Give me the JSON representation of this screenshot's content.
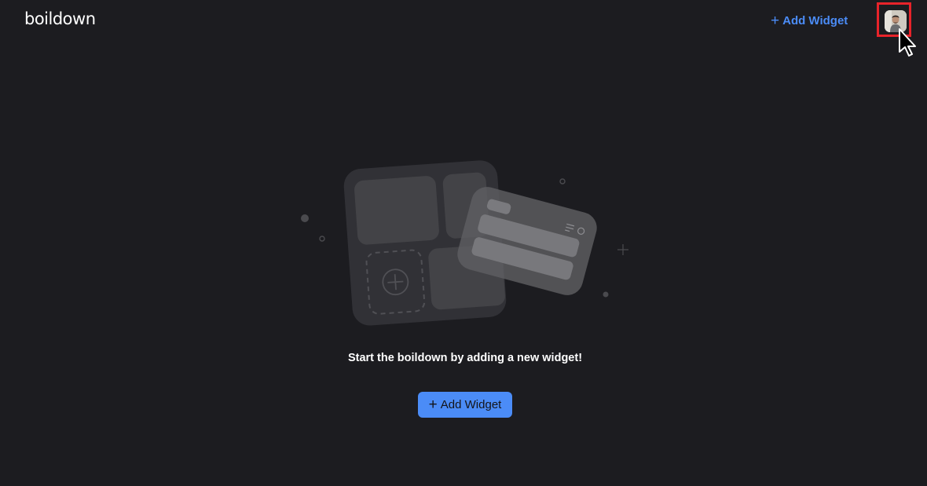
{
  "app": {
    "name": "boildown"
  },
  "header": {
    "add_widget_icon": "plus-icon",
    "add_widget_plus": "+",
    "add_widget_label": "Add Widget",
    "avatar_icon": "user-avatar",
    "highlight_color": "#e8232a"
  },
  "empty_state": {
    "illustration": "widgets-illustration",
    "message": "Start the boildown by adding a new widget!",
    "button_plus": "+",
    "button_label": "Add Widget"
  },
  "colors": {
    "accent": "#4b8cf7",
    "background": "#1c1c20"
  }
}
